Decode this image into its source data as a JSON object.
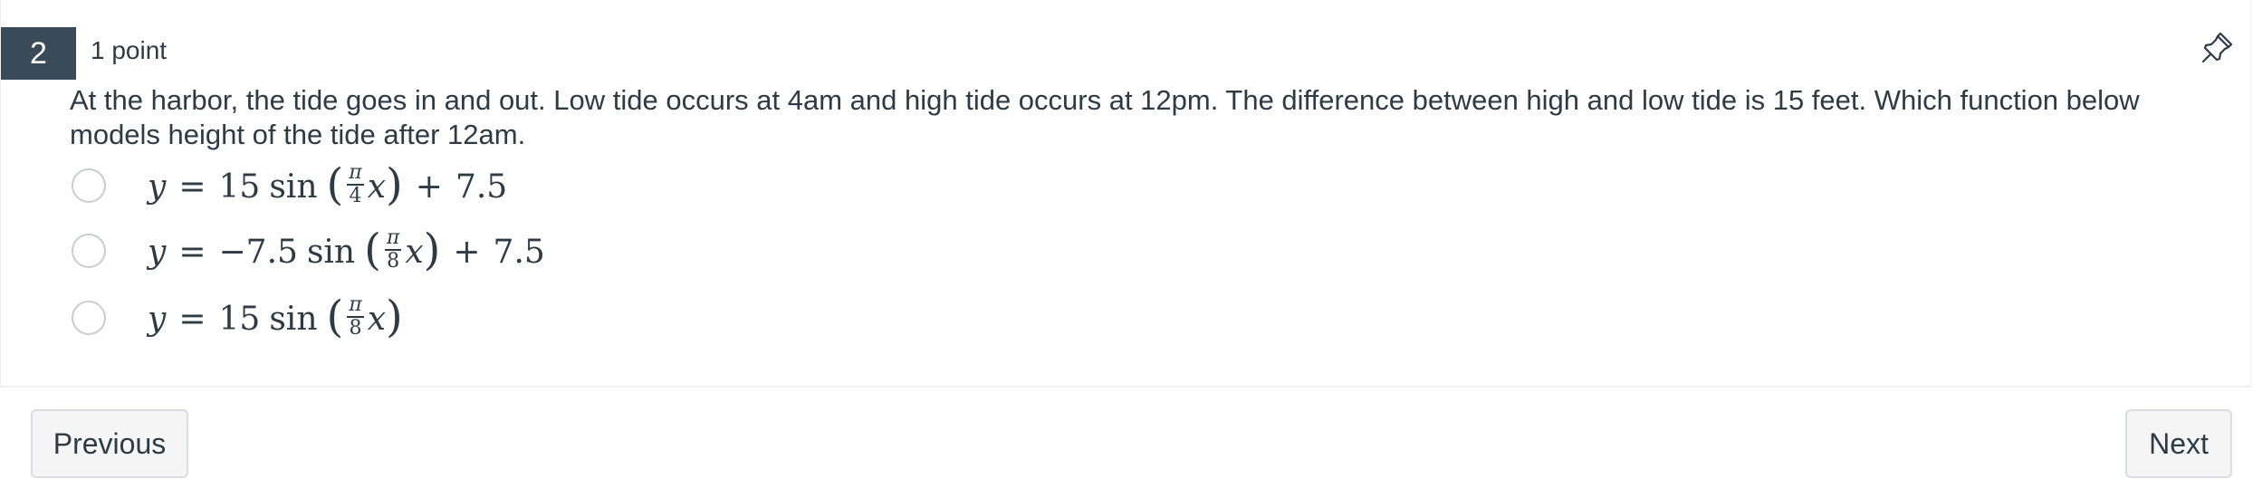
{
  "question": {
    "number": "2",
    "points": "1 point",
    "text": "At the harbor, the tide goes in and out.  Low tide occurs at 4am and high tide occurs at 12pm.  The difference between high and low tide is 15 feet.  Which function below models height of the tide after 12am."
  },
  "answers": [
    {
      "var": "y",
      "eq": "=",
      "coef": "15",
      "fn": "sin",
      "num": "π",
      "den": "4",
      "x": "x",
      "tail_op": "+",
      "tail_val": "7.5"
    },
    {
      "var": "y",
      "eq": "=",
      "coef": "−7.5",
      "fn": "sin",
      "num": "π",
      "den": "8",
      "x": "x",
      "tail_op": "+",
      "tail_val": "7.5"
    },
    {
      "var": "y",
      "eq": "=",
      "coef": "15",
      "fn": "sin",
      "num": "π",
      "den": "8",
      "x": "x",
      "tail_op": "",
      "tail_val": ""
    }
  ],
  "nav": {
    "previous_label": "Previous",
    "next_label": "Next"
  },
  "icons": {
    "pin": "pin-icon"
  }
}
